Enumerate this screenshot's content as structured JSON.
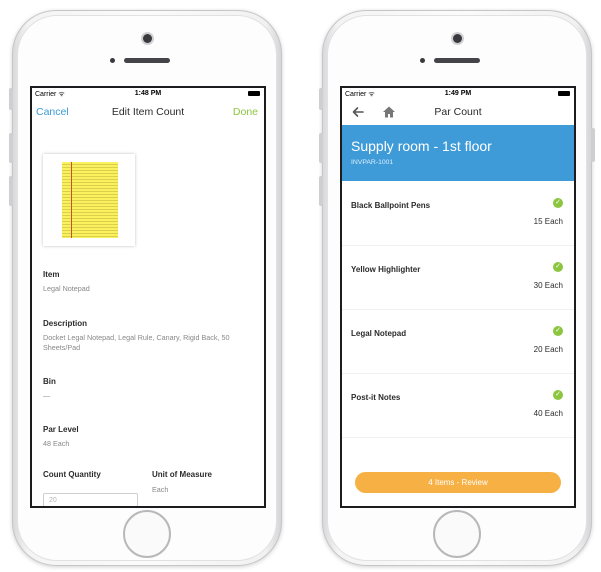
{
  "left_screen": {
    "status": {
      "carrier": "Carrier ᯤ",
      "time": "1:48 PM"
    },
    "nav": {
      "cancel": "Cancel",
      "title": "Edit Item Count",
      "done": "Done"
    },
    "fields": {
      "item_label": "Item",
      "item_value": "Legal Notepad",
      "description_label": "Description",
      "description_value": "Docket Legal Notepad, Legal Rule, Canary, Rigid Back, 50 Sheets/Pad",
      "bin_label": "Bin",
      "bin_value": "—",
      "par_label": "Par Level",
      "par_value": "48 Each",
      "count_label": "Count Quantity",
      "count_value": "20",
      "unit_label": "Unit of Measure",
      "unit_value": "Each"
    }
  },
  "right_screen": {
    "status": {
      "carrier": "Carrier ᯤ",
      "time": "1:49 PM"
    },
    "nav": {
      "title": "Par Count",
      "back_icon": "arrow-left-icon",
      "home_icon": "home-icon"
    },
    "location": {
      "name": "Supply room - 1st floor",
      "code": "INVPAR-1001"
    },
    "items": [
      {
        "name": "Black Ballpoint Pens",
        "qty": "15 Each"
      },
      {
        "name": "Yellow Highlighter",
        "qty": "30 Each"
      },
      {
        "name": "Legal Notepad",
        "qty": "20 Each"
      },
      {
        "name": "Post-it Notes",
        "qty": "40 Each"
      }
    ],
    "review_button": "4 Items - Review"
  },
  "colors": {
    "accent_blue": "#3f9bd8",
    "done_green": "#8cc63f",
    "review_orange": "#f7b044"
  }
}
